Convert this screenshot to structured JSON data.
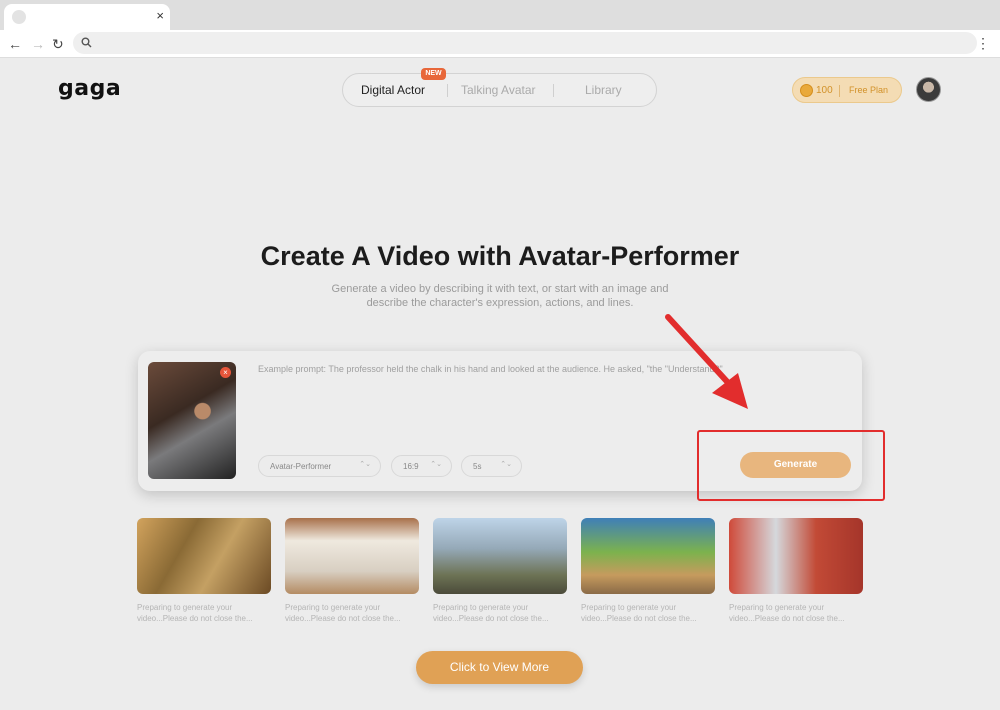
{
  "browser": {
    "tab_close": "×",
    "back": "←",
    "forward": "→",
    "reload": "↻",
    "menu": "⋮",
    "icons": [
      "search-icon"
    ]
  },
  "app": {
    "logo": "gaga",
    "tabs": [
      {
        "label": "Digital Actor",
        "active": true
      },
      {
        "label": "Talking Avatar",
        "active": false
      },
      {
        "label": "Library",
        "active": false
      }
    ],
    "new_badge": "NEW",
    "credits": "100",
    "plan": "Free Plan"
  },
  "hero": {
    "title": "Create A Video with Avatar-Performer",
    "subtitle_line1": "Generate a video by describing it with text, or start with an image and",
    "subtitle_line2": "describe the character's expression, actions, and lines."
  },
  "composer": {
    "remove": "×",
    "prompt_placeholder": "Example prompt: The professor held the chalk in his hand and looked at the audience. He asked, \"the \"Understand?\"",
    "model": "Avatar-Performer",
    "aspect_ratio": "16:9",
    "duration": "5s",
    "select_chevron": "⌃⌄",
    "generate": "Generate"
  },
  "samples": [
    {
      "caption": "Preparing to generate your video...Please do not close the..."
    },
    {
      "caption": "Preparing to generate your video...Please do not close the..."
    },
    {
      "caption": "Preparing to generate your video...Please do not close the..."
    },
    {
      "caption": "Preparing to generate your video...Please do not close the..."
    },
    {
      "caption": "Preparing to generate your video...Please do not close the..."
    }
  ],
  "view_more": "Click to View More",
  "colors": {
    "accent": "#e0a155",
    "annotation": "#e22d2d",
    "badge": "#e8673a"
  }
}
